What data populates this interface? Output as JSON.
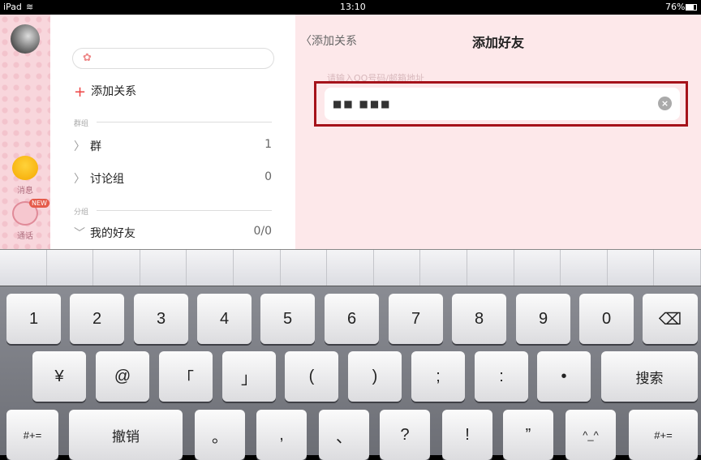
{
  "status": {
    "device": "iPad",
    "time": "13:10",
    "battery": "76%"
  },
  "nav": {
    "messages": "消息",
    "calls": "通话",
    "new_badge": "NEW"
  },
  "list": {
    "add_relation": "添加关系",
    "group_section": "群组",
    "rows": [
      {
        "label": "群",
        "count": "1"
      },
      {
        "label": "讨论组",
        "count": "0"
      }
    ],
    "friends_section": "分组",
    "friends": {
      "label": "我的好友",
      "count": "0/0"
    }
  },
  "main": {
    "back": "添加关系",
    "title": "添加好友",
    "placeholder": "请输入QQ号码/邮箱地址",
    "value": "■■ ■■■"
  },
  "keyboard": {
    "row1": [
      "1",
      "2",
      "3",
      "4",
      "5",
      "6",
      "7",
      "8",
      "9",
      "0",
      "⌫"
    ],
    "row2": [
      "¥",
      "@",
      "「",
      "」",
      "(",
      ")",
      ";",
      ":",
      "•",
      "搜索"
    ],
    "row3": [
      "#+=",
      "撤销",
      "。",
      ",",
      "、",
      "?",
      "!",
      "”",
      "^_^",
      "#+="
    ]
  }
}
